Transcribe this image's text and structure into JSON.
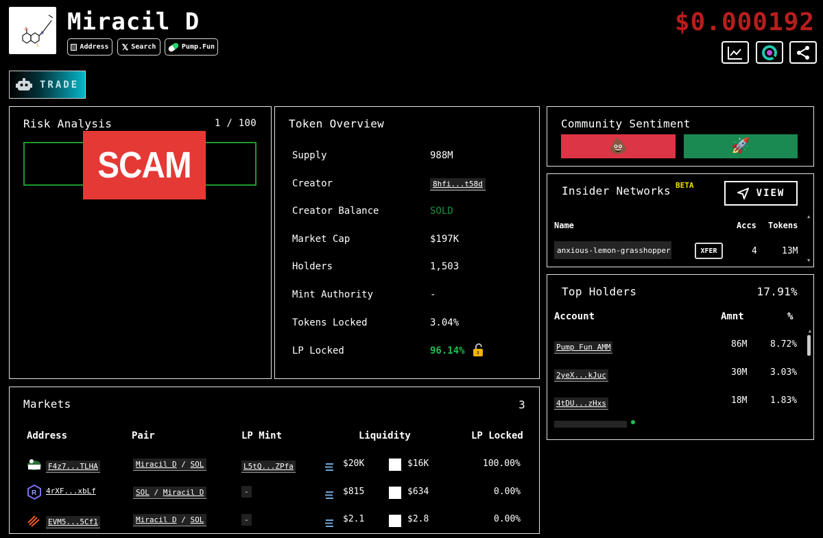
{
  "header": {
    "token_name": "Miracil D",
    "price": "$0.000192",
    "buttons": {
      "address": "Address",
      "search": "Search",
      "pumpfun": "Pump.Fun"
    },
    "trade_label": "TRADE"
  },
  "risk": {
    "title": "Risk Analysis",
    "score": "1 / 100",
    "badge": "SCAM"
  },
  "overview": {
    "title": "Token Overview",
    "rows": [
      {
        "label": "Supply",
        "value": "988M"
      },
      {
        "label": "Creator",
        "value": "8hfi...t58d"
      },
      {
        "label": "Creator Balance",
        "value": "SOLD"
      },
      {
        "label": "Market Cap",
        "value": "$197K"
      },
      {
        "label": "Holders",
        "value": "1,503"
      },
      {
        "label": "Mint Authority",
        "value": "-"
      },
      {
        "label": "Tokens Locked",
        "value": "3.04%"
      },
      {
        "label": "LP Locked",
        "value": "96.14%"
      }
    ],
    "colors": {
      "sold": "#1e8f3e",
      "lp_locked": "#1fbf54"
    }
  },
  "sentiment": {
    "title": "Community Sentiment",
    "bad_emoji": "💩",
    "good_emoji": "🚀",
    "colors": {
      "bad": "#dc3545",
      "good": "#1a8a52"
    }
  },
  "insider": {
    "title": "Insider Networks",
    "beta": "BETA",
    "view": "VIEW",
    "headers": {
      "name": "Name",
      "accs": "Accs",
      "tokens": "Tokens"
    },
    "row": {
      "name": "anxious-lemon-grasshopper",
      "xfer": "XFER",
      "accs": "4",
      "tokens": "13M"
    }
  },
  "holders": {
    "title": "Top Holders",
    "total": "17.91%",
    "headers": {
      "account": "Account",
      "amnt": "Amnt",
      "pct": "%"
    },
    "rows": [
      {
        "account": "Pump Fun AMM",
        "amnt": "86M",
        "pct": "8.72%"
      },
      {
        "account": "2yeX...kJuc",
        "amnt": "30M",
        "pct": "3.03%"
      },
      {
        "account": "4tDU...zHxs",
        "amnt": "18M",
        "pct": "1.83%"
      }
    ]
  },
  "markets": {
    "title": "Markets",
    "count": "3",
    "headers": {
      "address": "Address",
      "pair": "Pair",
      "lp_mint": "LP Mint",
      "liquidity": "Liquidity",
      "lp_locked": "LP Locked"
    },
    "rows": [
      {
        "address": "F4z7...TLHA",
        "pair_a": "Miracil D",
        "pair_b": "SOL",
        "lp_mint": "L5tQ...ZPfa",
        "liq_sol": "$20K",
        "liq_tok": "$16K",
        "lp_locked": "100.00%"
      },
      {
        "address": "4rXF...xbLf",
        "pair_a": "SOL",
        "pair_b": "Miracil D",
        "lp_mint": "-",
        "liq_sol": "$815",
        "liq_tok": "$634",
        "lp_locked": "0.00%"
      },
      {
        "address": "EVM5...5Cf1",
        "pair_a": "Miracil D",
        "pair_b": "SOL",
        "lp_mint": "-",
        "liq_sol": "$2.1",
        "liq_tok": "$2.8",
        "lp_locked": "0.00%"
      }
    ],
    "pair_sep": "/"
  },
  "colors": {
    "price": "#b81d1d",
    "scam_badge": "#e53935",
    "risk_border": "#1f9a2e",
    "beta": "#f1e000",
    "trade_accent": "#07b6c9"
  }
}
